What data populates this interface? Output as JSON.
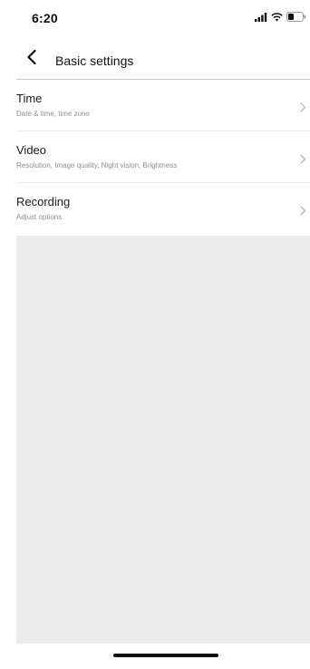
{
  "status_bar": {
    "time": "6:20",
    "icons": [
      "signal-icon",
      "wifi-icon",
      "battery-icon"
    ]
  },
  "nav": {
    "back_icon": "chevron-left-icon",
    "title": "Basic settings"
  },
  "settings": {
    "items": [
      {
        "title": "Time",
        "subtitle": "Date & time, time zone"
      },
      {
        "title": "Video",
        "subtitle": "Resolution, Image quality, Night vision, Brightness"
      },
      {
        "title": "Recording",
        "subtitle": "Adjust options"
      }
    ],
    "chevron_icon": "chevron-right-icon"
  },
  "colors": {
    "nav_divider": "#a9d4e6",
    "background": "#ebebeb",
    "subtitle_text": "#8f8f8f"
  }
}
